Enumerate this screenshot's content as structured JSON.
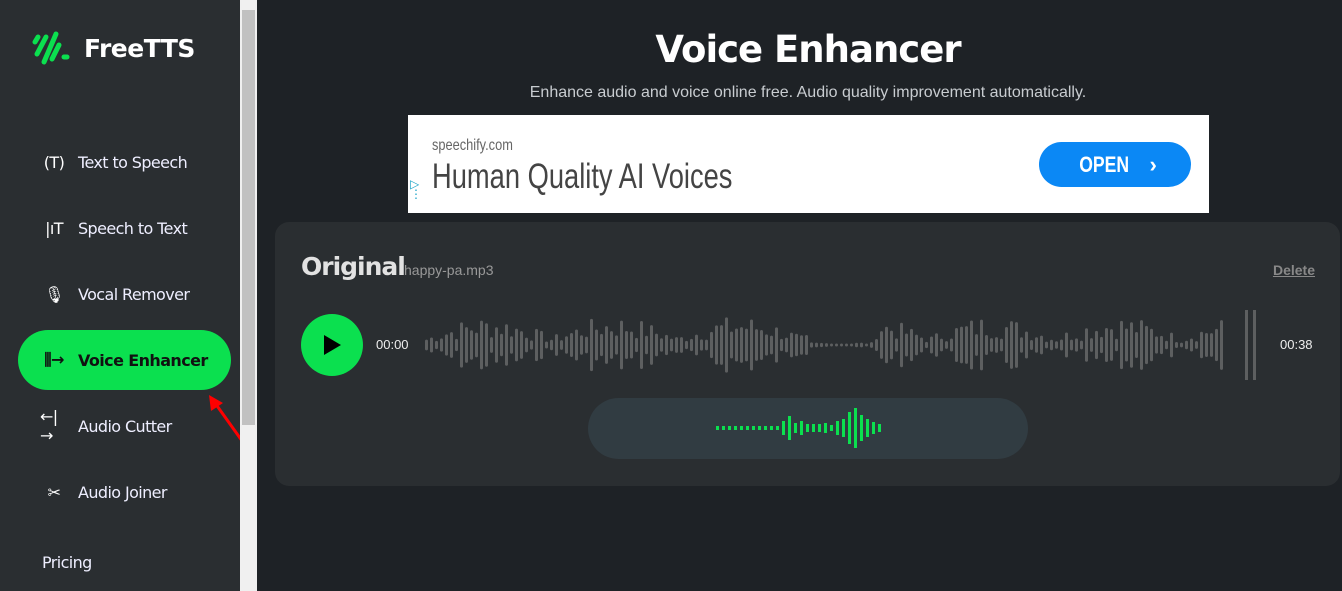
{
  "brand": {
    "name": "FreeTTS",
    "accent": "#0be04f"
  },
  "sidebar": {
    "items": [
      {
        "label": "Text to Speech",
        "icon": "text-speech-icon"
      },
      {
        "label": "Speech to Text",
        "icon": "speech-text-icon"
      },
      {
        "label": "Vocal Remover",
        "icon": "microphone-icon"
      },
      {
        "label": "Voice Enhancer",
        "icon": "enhance-icon",
        "active": true
      },
      {
        "label": "Audio Cutter",
        "icon": "cutter-icon"
      },
      {
        "label": "Audio Joiner",
        "icon": "scissors-icon"
      }
    ],
    "pricing": "Pricing"
  },
  "header": {
    "title": "Voice Enhancer",
    "subtitle": "Enhance audio and voice online free. Audio quality improvement automatically."
  },
  "ad": {
    "domain": "speechify.com",
    "headline": "Human Quality AI Voices",
    "button": "OPEN"
  },
  "player": {
    "label": "Original",
    "filename": "happy-pa.mp3",
    "delete": "Delete",
    "current_time": "00:00",
    "duration": "00:38",
    "progress": 0
  }
}
